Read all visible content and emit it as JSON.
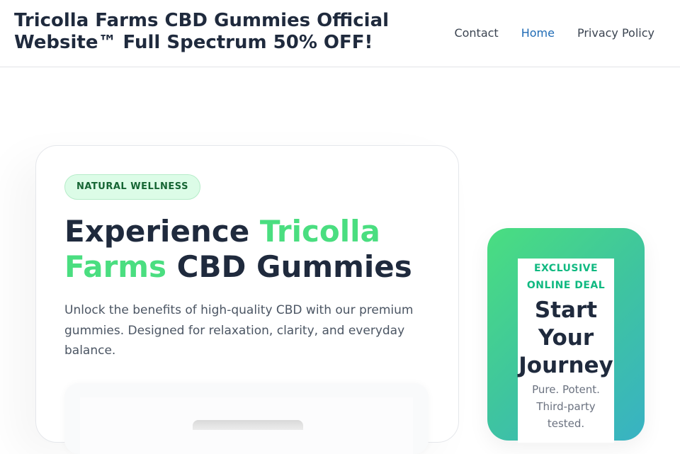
{
  "header": {
    "site_title": "Tricolla Farms CBD Gummies Official Website™ Full Spectrum 50% OFF!",
    "nav": [
      {
        "label": "Contact",
        "active": false
      },
      {
        "label": "Home",
        "active": true
      },
      {
        "label": "Privacy Policy",
        "active": false
      }
    ]
  },
  "hero": {
    "badge": "NATURAL WELLNESS",
    "headline_part1": "Experience ",
    "headline_accent": "Tricolla Farms",
    "headline_part2": " CBD Gummies",
    "lead": "Unlock the benefits of high-quality CBD with our premium gummies. Designed for relaxation, clarity, and everyday balance."
  },
  "offer": {
    "eyebrow": "EXCLUSIVE ONLINE DEAL",
    "title": "Start Your Journey",
    "subtitle": "Pure. Potent. Third-party tested."
  },
  "colors": {
    "accent_green": "#4ade80",
    "link_blue": "#1f6bb5",
    "badge_bg": "#dcfce7"
  }
}
